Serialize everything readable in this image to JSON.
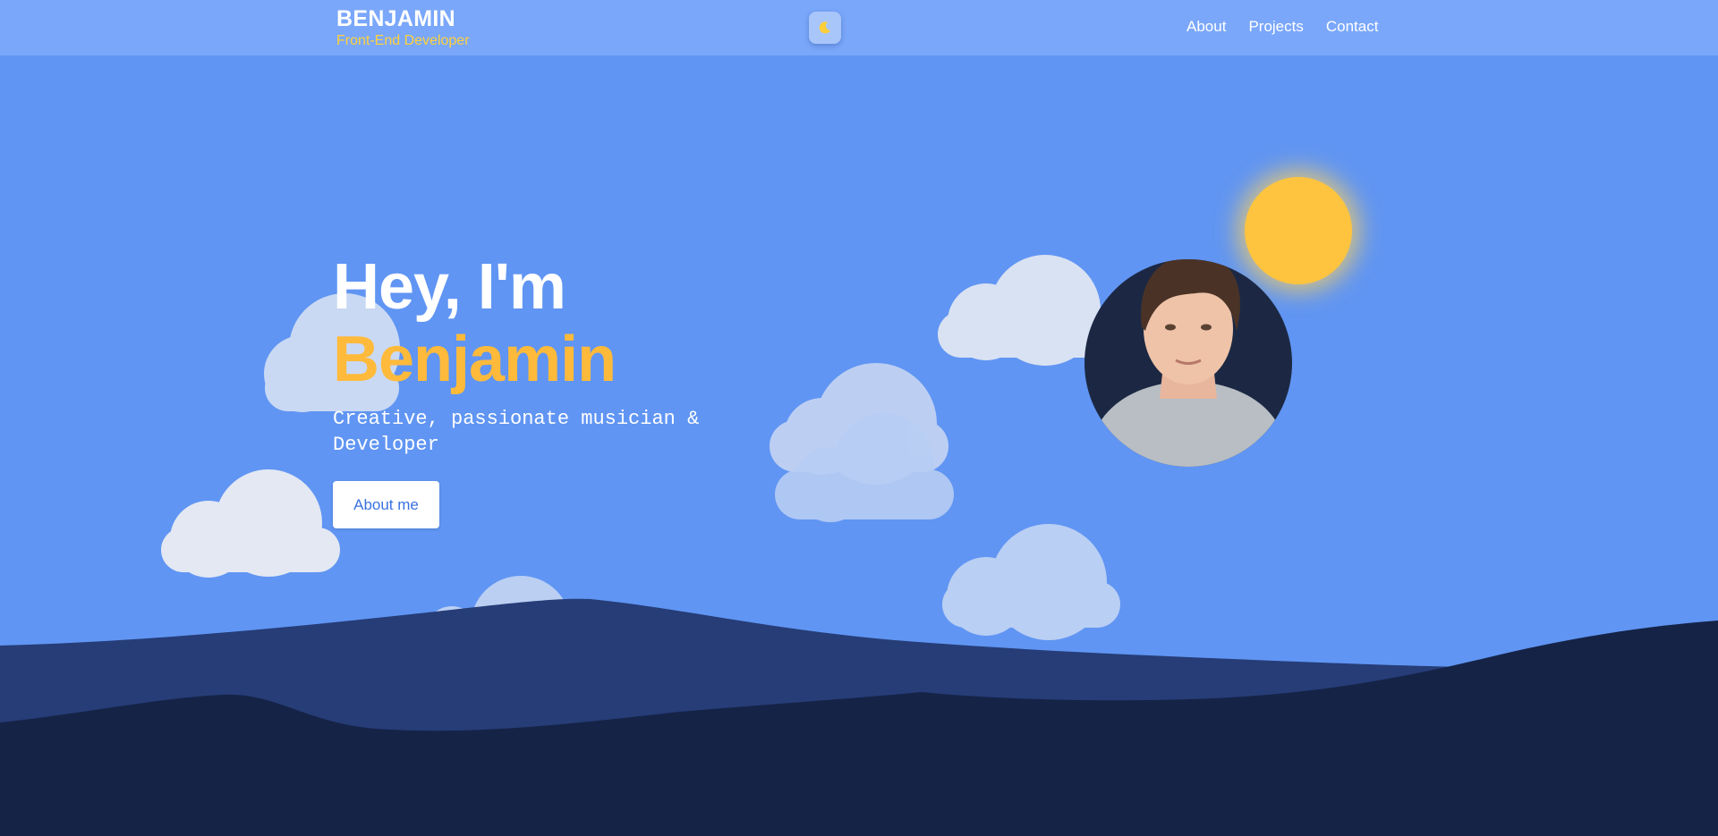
{
  "header": {
    "brand_name": "BENJAMIN",
    "brand_role": "Front-End Developer",
    "theme_toggle_icon": "moon-icon",
    "nav": [
      {
        "label": "About"
      },
      {
        "label": "Projects"
      },
      {
        "label": "Contact"
      }
    ]
  },
  "hero": {
    "greeting": "Hey, I'm",
    "name": "Benjamin",
    "subtitle": "Creative, passionate musician & Developer",
    "button_label": "About me"
  },
  "decor": {
    "sun": "sun-icon",
    "clouds": "cloud-icon",
    "portrait": "portrait-avatar"
  },
  "colors": {
    "sky": "#6095f3",
    "header": "#7aa7fa",
    "accent_yellow": "#ffc43f",
    "hill_back": "#263d77",
    "hill_front": "#152347"
  }
}
